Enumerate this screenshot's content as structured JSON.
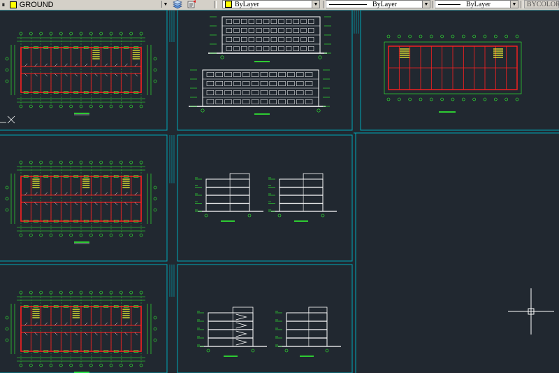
{
  "toolbar": {
    "layer_name": "GROUND",
    "color_value": "ByLayer",
    "linetype_value": "ByLayer",
    "lineweight_value": "ByLayer",
    "plotstyle_value": "BYCOLOR"
  },
  "colors": {
    "background": "#212830",
    "viewport_border": "#00a8b8",
    "grid_green": "#33ff33",
    "wall_red": "#ff2020",
    "stair_yellow": "#ffff33",
    "elevation_white": "#ffffff"
  },
  "viewports": [
    {
      "name": "floor-plan-1"
    },
    {
      "name": "front-elevation"
    },
    {
      "name": "roof-plan"
    },
    {
      "name": "floor-plan-2"
    },
    {
      "name": "sections-a"
    },
    {
      "name": "floor-plan-3"
    },
    {
      "name": "sections-b"
    }
  ],
  "icons": [
    "layer-state-icon",
    "layer-color-swatch",
    "match-properties-icon",
    "crosshair-cursor"
  ]
}
